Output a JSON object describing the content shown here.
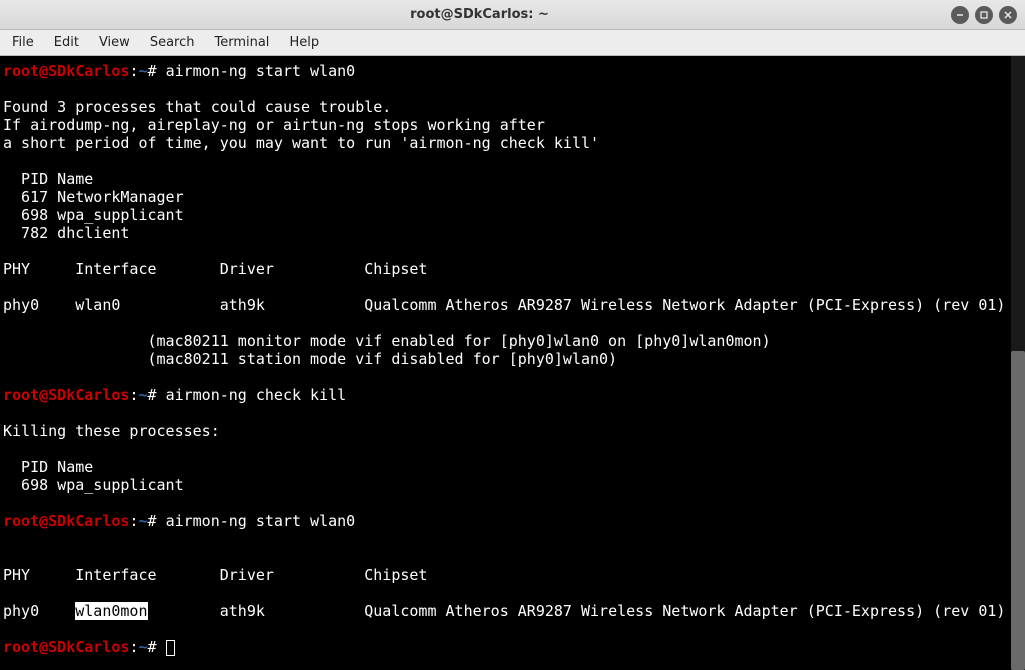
{
  "window": {
    "title": "root@SDkCarlos: ~"
  },
  "menu": {
    "items": [
      "File",
      "Edit",
      "View",
      "Search",
      "Terminal",
      "Help"
    ]
  },
  "prompt": {
    "user_host": "root@SDkCarlos",
    "sep1": ":",
    "path": "~",
    "sep2": "#"
  },
  "session": {
    "cmd1": "airmon-ng start wlan0",
    "out1_l1": "Found 3 processes that could cause trouble.",
    "out1_l2": "If airodump-ng, aireplay-ng or airtun-ng stops working after",
    "out1_l3": "a short period of time, you may want to run 'airmon-ng check kill'",
    "out1_hd": "  PID Name",
    "out1_p1": "  617 NetworkManager",
    "out1_p2": "  698 wpa_supplicant",
    "out1_p3": "  782 dhclient",
    "out1_tblhead": "PHY     Interface       Driver          Chipset",
    "out1_tblrow": "phy0    wlan0           ath9k           Qualcomm Atheros AR9287 Wireless Network Adapter (PCI-Express) (rev 01)",
    "out1_m1": "                (mac80211 monitor mode vif enabled for [phy0]wlan0 on [phy0]wlan0mon)",
    "out1_m2": "                (mac80211 station mode vif disabled for [phy0]wlan0)",
    "cmd2": "airmon-ng check kill",
    "out2_l1": "Killing these processes:",
    "out2_hd": "  PID Name",
    "out2_p1": "  698 wpa_supplicant",
    "cmd3": "airmon-ng start wlan0",
    "out3_tblhead": "PHY     Interface       Driver          Chipset",
    "out3_pre": "phy0    ",
    "out3_iface": "wlan0mon",
    "out3_post": "        ath9k           Qualcomm Atheros AR9287 Wireless Network Adapter (PCI-Express) (rev 01)"
  }
}
